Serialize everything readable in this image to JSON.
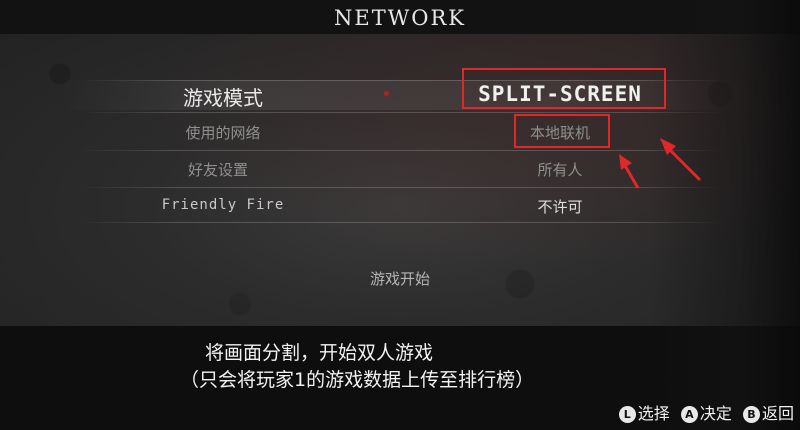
{
  "screen": {
    "title": "NETWORK"
  },
  "settings": [
    {
      "label": "游戏模式",
      "value": "SPLIT-SCREEN"
    },
    {
      "label": "使用的网络",
      "value": "本地联机"
    },
    {
      "label": "好友设置",
      "value": "所有人"
    },
    {
      "label": "Friendly Fire",
      "value": "不许可"
    }
  ],
  "start_label": "游戏开始",
  "description": {
    "line1": "将画面分割，开始双人游戏",
    "line2": "（只会将玩家1的游戏数据上传至排行榜）"
  },
  "footer": {
    "hints": [
      {
        "button": "L",
        "label": "选择"
      },
      {
        "button": "A",
        "label": "决定"
      },
      {
        "button": "B",
        "label": "返回"
      }
    ]
  },
  "colors": {
    "annotation": "#e0272a",
    "cursor": "#b81f1f"
  }
}
